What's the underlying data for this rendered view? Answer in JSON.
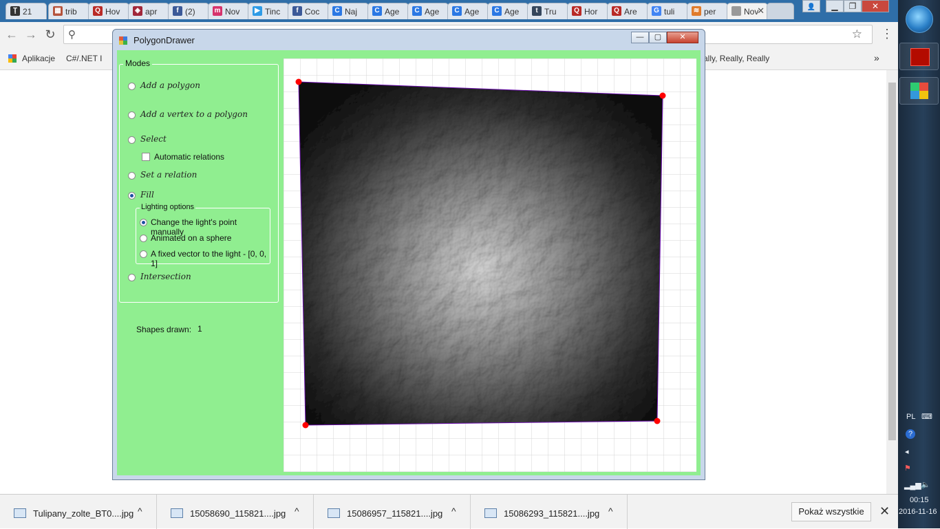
{
  "browser": {
    "tabs": [
      {
        "label": "21",
        "favicon_color": "#333333",
        "favicon_glyph": "Ţ"
      },
      {
        "label": "trib",
        "favicon_color": "#b5533c",
        "favicon_glyph": "▦"
      },
      {
        "label": "Hov",
        "favicon_color": "#b92b27",
        "favicon_glyph": "Q"
      },
      {
        "label": "apr",
        "favicon_color": "#a1273a",
        "favicon_glyph": "◈"
      },
      {
        "label": "(2)",
        "favicon_color": "#3b5998",
        "favicon_glyph": "f"
      },
      {
        "label": "Nov",
        "favicon_color": "#d6336c",
        "favicon_glyph": "m"
      },
      {
        "label": "Tinc",
        "favicon_color": "#2e9be6",
        "favicon_glyph": "▶"
      },
      {
        "label": "Coc",
        "favicon_color": "#3b5998",
        "favicon_glyph": "f"
      },
      {
        "label": "Naj",
        "favicon_color": "#2b78e4",
        "favicon_glyph": "C"
      },
      {
        "label": "Age",
        "favicon_color": "#2b78e4",
        "favicon_glyph": "C"
      },
      {
        "label": "Age",
        "favicon_color": "#2b78e4",
        "favicon_glyph": "C"
      },
      {
        "label": "Age",
        "favicon_color": "#2b78e4",
        "favicon_glyph": "C"
      },
      {
        "label": "Age",
        "favicon_color": "#2b78e4",
        "favicon_glyph": "C"
      },
      {
        "label": "Tru",
        "favicon_color": "#35465c",
        "favicon_glyph": "t"
      },
      {
        "label": "Hor",
        "favicon_color": "#b92b27",
        "favicon_glyph": "Q"
      },
      {
        "label": "Are",
        "favicon_color": "#b92b27",
        "favicon_glyph": "Q"
      },
      {
        "label": "tuli",
        "favicon_color": "#4285f4",
        "favicon_glyph": "G"
      },
      {
        "label": "per",
        "favicon_color": "#e07b2b",
        "favicon_glyph": "≋"
      },
      {
        "label": "Nov",
        "favicon_color": "#999999",
        "favicon_glyph": ""
      }
    ],
    "tab_close_glyph": "✕",
    "back_glyph": "←",
    "forward_glyph": "→",
    "reload_glyph": "↻",
    "search_glyph": "⚲",
    "star_glyph": "☆",
    "menu_glyph": "⋮",
    "bookmarks": {
      "apps_label": "Aplikacje",
      "item1_label": "C#/.NET I",
      "item_right_label": "ally, Really, Really",
      "more_glyph": "»"
    }
  },
  "app": {
    "title": "PolygonDrawer",
    "minimize_glyph": "—",
    "maximize_glyph": "▢",
    "close_glyph": "✕",
    "modes": {
      "legend": "Modes",
      "add_polygon": "Add a polygon",
      "add_vertex": "Add a vertex to a polygon",
      "select": "Select",
      "automatic_relations": "Automatic relations",
      "set_relation": "Set a relation",
      "fill": "Fill",
      "lighting": {
        "legend": "Lighting options",
        "manual": "Change the light's point manually",
        "animated": "Animated on a sphere",
        "fixed": "A fixed vector to the light - [0, 0, 1]"
      },
      "intersection": "Intersection"
    },
    "selected_mode": "fill",
    "selected_lighting": "manual",
    "automatic_relations_checked": false,
    "shapes_drawn_label": "Shapes drawn:",
    "shapes_drawn_value": "1",
    "background_color": "#90ee90",
    "vertex_color": "#ff0000",
    "edge_color": "#6a0dad"
  },
  "downloads": {
    "items": [
      {
        "name": "Tulipany_zolte_BT0....jpg"
      },
      {
        "name": "15058690_115821....jpg"
      },
      {
        "name": "15086957_115821....jpg"
      },
      {
        "name": "15086293_115821....jpg"
      }
    ],
    "chevron_glyph": "^",
    "show_all": "Pokaż wszystkie",
    "close_glyph": "✕"
  },
  "taskbar": {
    "lang": "PL",
    "time": "00:15",
    "date": "2016-11-16"
  }
}
